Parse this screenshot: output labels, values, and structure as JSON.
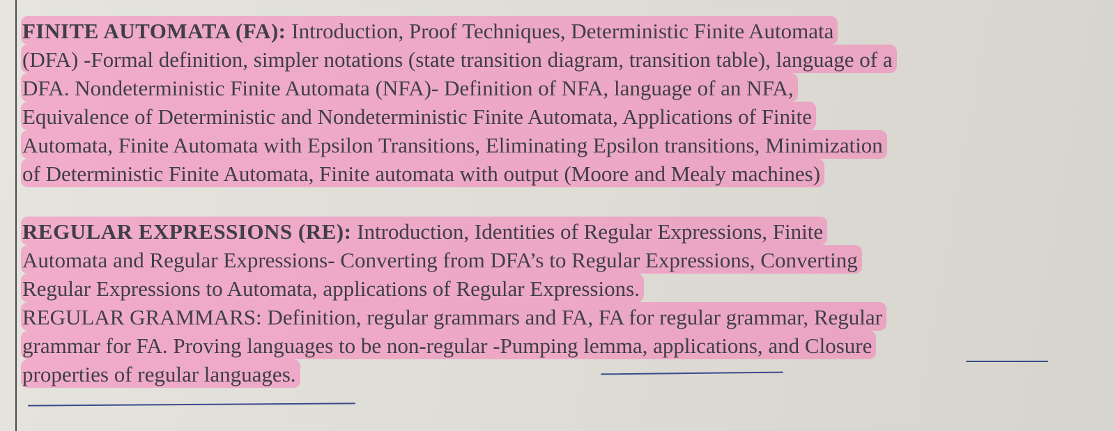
{
  "sections": [
    {
      "heading": "FINITE AUTOMATA (FA):",
      "lines": [
        " Introduction, Proof Techniques, Deterministic Finite Automata",
        "(DFA) -Formal definition, simpler notations (state transition diagram, transition table), language of a",
        "DFA. Nondeterministic Finite Automata (NFA)- Definition of NFA, language of an NFA,",
        "Equivalence of Deterministic and Nondeterministic Finite Automata, Applications of Finite",
        "Automata, Finite Automata with Epsilon Transitions, Eliminating Epsilon transitions, Minimization",
        "of Deterministic Finite Automata, Finite automata with output (Moore and Mealy machines)"
      ]
    },
    {
      "heading": "REGULAR EXPRESSIONS (RE):",
      "lines": [
        " Introduction, Identities of Regular Expressions, Finite",
        "Automata and Regular Expressions- Converting from DFA’s to Regular Expressions, Converting",
        "Regular Expressions to Automata, applications of Regular Expressions.",
        "REGULAR GRAMMARS: Definition, regular grammars and FA, FA for regular grammar, Regular",
        "grammar for FA. Proving languages to be non-regular -Pumping lemma, applications, and Closure",
        "properties of regular languages."
      ]
    }
  ]
}
